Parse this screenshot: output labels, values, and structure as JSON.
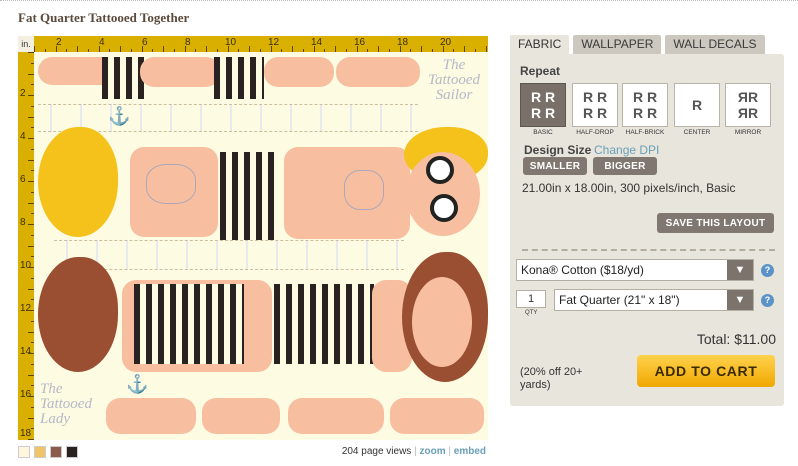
{
  "page": {
    "title": "Fat Quarter Tattooed Together"
  },
  "ruler": {
    "corner_label": "in.",
    "top_labels": [
      "2",
      "4",
      "6",
      "8",
      "10",
      "12",
      "14",
      "16",
      "18",
      "20"
    ],
    "left_labels": [
      "2",
      "4",
      "6",
      "8",
      "10",
      "12",
      "14",
      "16",
      "18"
    ]
  },
  "design": {
    "text_top": "The Tattooed Sailor",
    "text_bottom": "The Tattooed Lady",
    "colors": {
      "background": "#fdfbe2",
      "skin": "#f7bfa0",
      "stripe": "#2a2220",
      "hair_yellow": "#f4c21a",
      "hair_brown": "#9a4e32"
    }
  },
  "swatches": [
    "#fdf6dc",
    "#f2c46a",
    "#8a5a4a",
    "#2a2220"
  ],
  "footer": {
    "views": "204 page views",
    "separator": "|",
    "zoom": "zoom",
    "embed": "embed"
  },
  "tabs": [
    {
      "label": "FABRIC",
      "active": true
    },
    {
      "label": "WALLPAPER",
      "active": false
    },
    {
      "label": "WALL DECALS",
      "active": false
    }
  ],
  "repeat": {
    "label": "Repeat",
    "options": [
      {
        "caption": "BASIC",
        "glyph": "R R\nR R",
        "selected": true
      },
      {
        "caption": "HALF-DROP",
        "glyph": "R R\nR R",
        "selected": false
      },
      {
        "caption": "HALF-BRICK",
        "glyph": "R R\nR R",
        "selected": false
      },
      {
        "caption": "CENTER",
        "glyph": "R",
        "selected": false
      },
      {
        "caption": "MIRROR",
        "glyph": "ЯR\nЯR",
        "selected": false
      }
    ]
  },
  "design_size": {
    "label": "Design Size",
    "change_dpi": "Change DPI",
    "smaller": "SMALLER",
    "bigger": "BIGGER",
    "dimensions": "21.00in x 18.00in, 300 pixels/inch, Basic",
    "save_layout": "SAVE THIS LAYOUT"
  },
  "purchase": {
    "fabric_select": "Kona® Cotton ($18/yd)",
    "qty_value": "1",
    "qty_label": "QTY",
    "size_select": "Fat Quarter (21\" x 18\")",
    "help": "?",
    "total": "Total: $11.00",
    "discount": "(20% off 20+ yards)",
    "add_to_cart": "ADD TO CART"
  }
}
